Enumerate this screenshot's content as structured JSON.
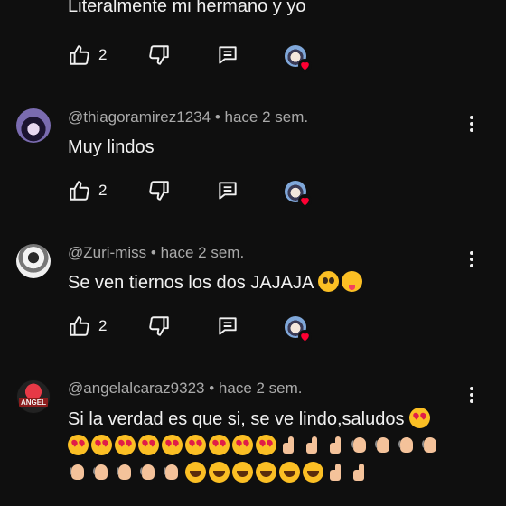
{
  "top_comment": {
    "cut_text": "Literalmente mi hermano y yo",
    "likes": "2"
  },
  "comments": [
    {
      "handle": "@thiagoramirez1234",
      "separator": "•",
      "time": "hace 2 sem.",
      "text": "Muy lindos",
      "likes": "2"
    },
    {
      "handle": "@Zuri-miss",
      "separator": "•",
      "time": "hace 2 sem.",
      "text": "Se ven tiernos los dos JAJAJA",
      "likes": "2"
    },
    {
      "handle": "@angelalcaraz9323",
      "separator": "•",
      "time": "hace 2 sem.",
      "text": "Si la verdad es que si, se ve lindo,saludos",
      "avatar_text": "ANGEL"
    }
  ],
  "colors": {
    "background": "#0f0f0f",
    "text": "#f1f1f1",
    "meta": "#aaaaaa",
    "heart": "#ff0033"
  },
  "icons": [
    "like-icon",
    "dislike-icon",
    "reply-icon",
    "more-vert-icon",
    "creator-heart-icon"
  ]
}
